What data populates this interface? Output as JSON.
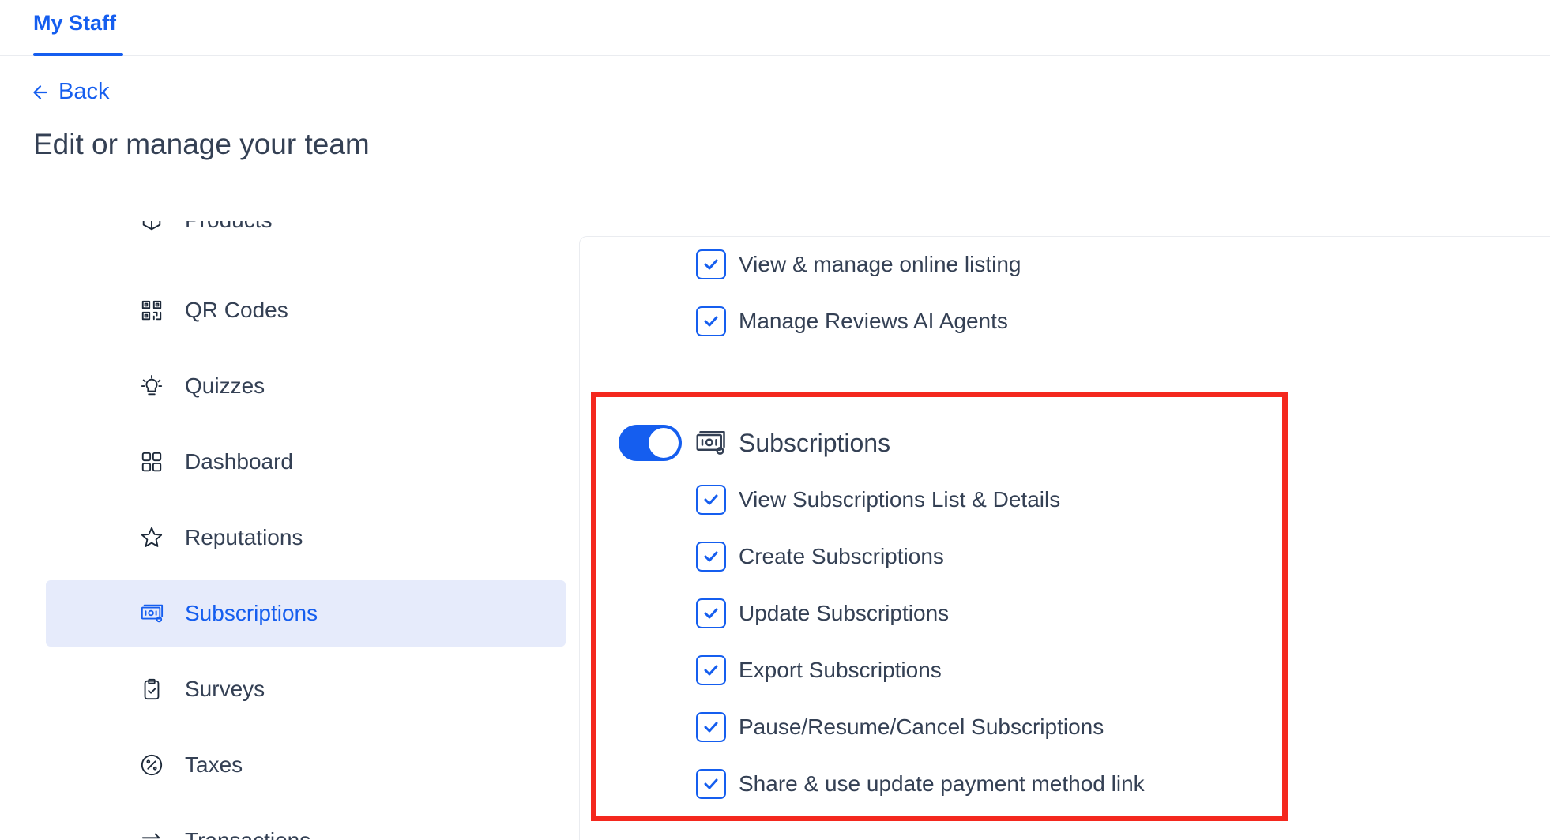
{
  "header": {
    "tab_label": "My Staff"
  },
  "nav": {
    "back_label": "Back"
  },
  "page": {
    "title": "Edit or manage your team"
  },
  "sidebar": {
    "items": [
      {
        "label": "Products",
        "icon": "products-icon"
      },
      {
        "label": "QR Codes",
        "icon": "qr-code-icon"
      },
      {
        "label": "Quizzes",
        "icon": "lightbulb-icon"
      },
      {
        "label": "Dashboard",
        "icon": "dashboard-grid-icon"
      },
      {
        "label": "Reputations",
        "icon": "star-icon"
      },
      {
        "label": "Subscriptions",
        "icon": "money-bill-icon",
        "active": true
      },
      {
        "label": "Surveys",
        "icon": "clipboard-icon"
      },
      {
        "label": "Taxes",
        "icon": "percent-icon"
      },
      {
        "label": "Transactions",
        "icon": "transactions-icon"
      }
    ]
  },
  "reviews_permissions": [
    {
      "label": "View & manage online listing",
      "checked": true
    },
    {
      "label": "Manage Reviews AI Agents",
      "checked": true
    }
  ],
  "subscriptions_section": {
    "title": "Subscriptions",
    "icon": "money-bill-icon",
    "enabled": true,
    "permissions": [
      {
        "label": "View Subscriptions List & Details",
        "checked": true
      },
      {
        "label": "Create Subscriptions",
        "checked": true
      },
      {
        "label": "Update Subscriptions",
        "checked": true
      },
      {
        "label": "Export Subscriptions",
        "checked": true
      },
      {
        "label": "Pause/Resume/Cancel Subscriptions",
        "checked": true
      },
      {
        "label": "Share & use update payment method link",
        "checked": true
      }
    ]
  },
  "colors": {
    "accent": "#155eef",
    "active_bg": "#e6ebfb",
    "highlight": "#f4281e",
    "text": "#344054"
  }
}
